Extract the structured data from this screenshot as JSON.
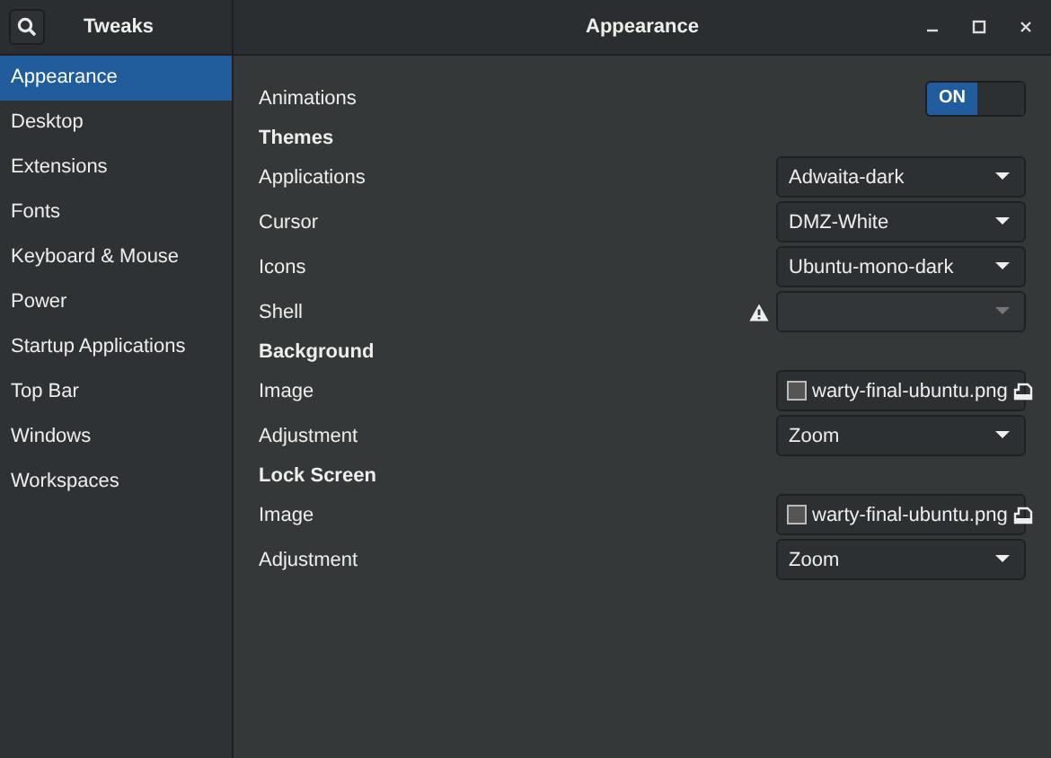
{
  "sidebar": {
    "title": "Tweaks",
    "items": [
      {
        "label": "Appearance",
        "selected": true
      },
      {
        "label": "Desktop",
        "selected": false
      },
      {
        "label": "Extensions",
        "selected": false
      },
      {
        "label": "Fonts",
        "selected": false
      },
      {
        "label": "Keyboard & Mouse",
        "selected": false
      },
      {
        "label": "Power",
        "selected": false
      },
      {
        "label": "Startup Applications",
        "selected": false
      },
      {
        "label": "Top Bar",
        "selected": false
      },
      {
        "label": "Windows",
        "selected": false
      },
      {
        "label": "Workspaces",
        "selected": false
      }
    ]
  },
  "window": {
    "title": "Appearance"
  },
  "rows": [
    {
      "kind": "switch",
      "label": "Animations",
      "on": true,
      "state_text": "ON"
    },
    {
      "kind": "header",
      "label": "Themes"
    },
    {
      "kind": "dropdown",
      "label": "Applications",
      "value": "Adwaita-dark",
      "disabled": false
    },
    {
      "kind": "dropdown",
      "label": "Cursor",
      "value": "DMZ-White",
      "disabled": false
    },
    {
      "kind": "dropdown",
      "label": "Icons",
      "value": "Ubuntu-mono-dark",
      "disabled": false
    },
    {
      "kind": "dropdown",
      "label": "Shell",
      "disabled": true,
      "warning": true
    },
    {
      "kind": "header",
      "label": "Background"
    },
    {
      "kind": "file",
      "label": "Image",
      "value": "warty-final-ubuntu.png"
    },
    {
      "kind": "dropdown",
      "label": "Adjustment",
      "value": "Zoom",
      "disabled": false
    },
    {
      "kind": "header",
      "label": "Lock Screen"
    },
    {
      "kind": "file",
      "label": "Image",
      "value": "warty-final-ubuntu.png"
    },
    {
      "kind": "dropdown",
      "label": "Adjustment",
      "value": "Zoom",
      "disabled": false
    }
  ]
}
